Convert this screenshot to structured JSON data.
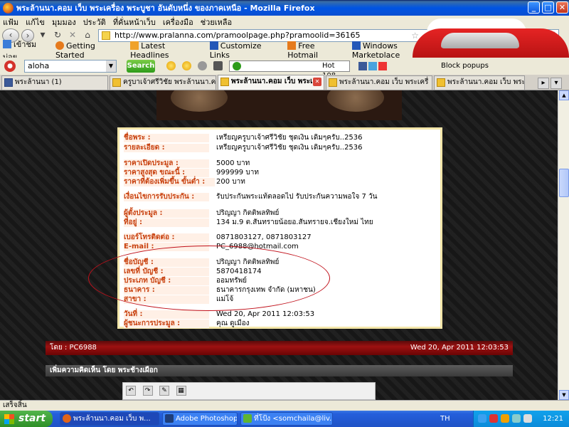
{
  "window": {
    "title": "พระล้านนา.คอม เว็บ พระเครื่อง พระบูชา อันดับหนึ่ง ของภาคเหนือ - Mozilla Firefox",
    "min": "_",
    "max": "□",
    "close": "✕"
  },
  "menu": [
    "แฟ้ม",
    "แก้ไข",
    "มุมมอง",
    "ประวัติ",
    "ที่คั่นหน้าเว็บ",
    "เครื่องมือ",
    "ช่วยเหลือ"
  ],
  "nav": {
    "url": "http://www.pralanna.com/pramoolpage.php?pramoolid=36165",
    "search_placeholder": "Search the web (Babylon)"
  },
  "bookmarks": [
    {
      "label": "เข้าชมบ่อย",
      "color": "#3b7dd8"
    },
    {
      "label": "Getting Started",
      "color": "#e57a1c"
    },
    {
      "label": "Latest Headlines",
      "color": "#f0a22a"
    },
    {
      "label": "Customize Links",
      "color": "#2457b8"
    },
    {
      "label": "Free Hotmail",
      "color": "#e57a1c"
    },
    {
      "label": "Windows Marketplace",
      "color": "#2457b8"
    },
    {
      "label": "Windows Media",
      "color": "#2457b8"
    },
    {
      "label": "Windows",
      "color": "#2457b8"
    }
  ],
  "toolbar": {
    "search_value": "aloha",
    "search_button": "Search",
    "player_text": "Hot 108",
    "popups": "Block popups"
  },
  "tabs": [
    {
      "label": "พระล้านนา (1)",
      "active": false
    },
    {
      "label": "ครูบาเจ้าศรีวิชัย พระล้านนา.ค...",
      "active": false
    },
    {
      "label": "พระล้านนา.คอม เว็บ พระเ...",
      "active": true
    },
    {
      "label": "พระล้านนา.คอม เว็บ พระเครื่",
      "active": false
    },
    {
      "label": "พระล้านนา.คอม เว็บ พระเครื่",
      "active": false
    }
  ],
  "info": [
    {
      "label": "ชื่อพระ :",
      "value": "เหรียญครูบาเจ้าศรีวิชัย ชุดเงิน เดิมๆครับ..2536"
    },
    {
      "label": "รายละเอียด :",
      "value": "เหรียญครูบาเจ้าศรีวิชัย ชุดเงิน เดิมๆครับ..2536"
    },
    {
      "label": "ราคาเปิดประมูล :",
      "value": "5000 บาท"
    },
    {
      "label": "ราคาสูงสุด ขณะนี้ :",
      "value": "999999 บาท"
    },
    {
      "label": "ราคาที่ต้องเพิ่มขึ้น ขั้นต่ำ :",
      "value": "200 บาท"
    },
    {
      "label": "เงื่อนไขการรับประกัน :",
      "value": "รับประกันพระแท้ตลอดไป รับประกันความพอใจ 7 วัน"
    },
    {
      "label": "ผู้ตั้งประมูล :",
      "value": "ปริญญา กิตติพลทิพย์"
    },
    {
      "label": "ที่อยู่ :",
      "value": "134 ม.9 ต.สันทรายน้อยอ.สันทรายจ.เชียงใหม่ ไทย"
    },
    {
      "label": "เบอร์โทรติดต่อ :",
      "value": " 0871803127, 0871803127"
    },
    {
      "label": "E-mail :",
      "value": "PC_6988@hotmail.com"
    },
    {
      "label": "ชื่อบัญชี :",
      "value": "ปริญญา กิตติพลทิพย์"
    },
    {
      "label": "เลขที่ บัญชี :",
      "value": "5870418174"
    },
    {
      "label": "ประเภท บัญชี :",
      "value": "ออมทรัพย์"
    },
    {
      "label": "ธนาคาร :",
      "value": "ธนาคารกรุงเทพ จำกัด (มหาชน)"
    },
    {
      "label": "สาขา :",
      "value": "แม่โจ้"
    },
    {
      "label": "วันที่ :",
      "value": "Wed 20, Apr 2011 12:03:53"
    },
    {
      "label": "ผู้ชนะการประมูล :",
      "value": "คุณ ดูเมือง"
    }
  ],
  "post": {
    "by": "โดย : PC6988",
    "date": "Wed 20, Apr 2011 12:03:53"
  },
  "comment_header": "เพิ่มความคิดเห็น โดย พระช้างเผือก",
  "status": "เสร็จสิ้น",
  "taskbar": {
    "start": "start",
    "tasks": [
      {
        "label": "พระล้านนา.คอม เว็บ พ...",
        "active": true
      },
      {
        "label": "Adobe Photoshop",
        "active": false
      },
      {
        "label": "ที่โป้ง <somchaila@liv...",
        "active": false
      }
    ],
    "lang": "TH",
    "clock": "12:21"
  }
}
